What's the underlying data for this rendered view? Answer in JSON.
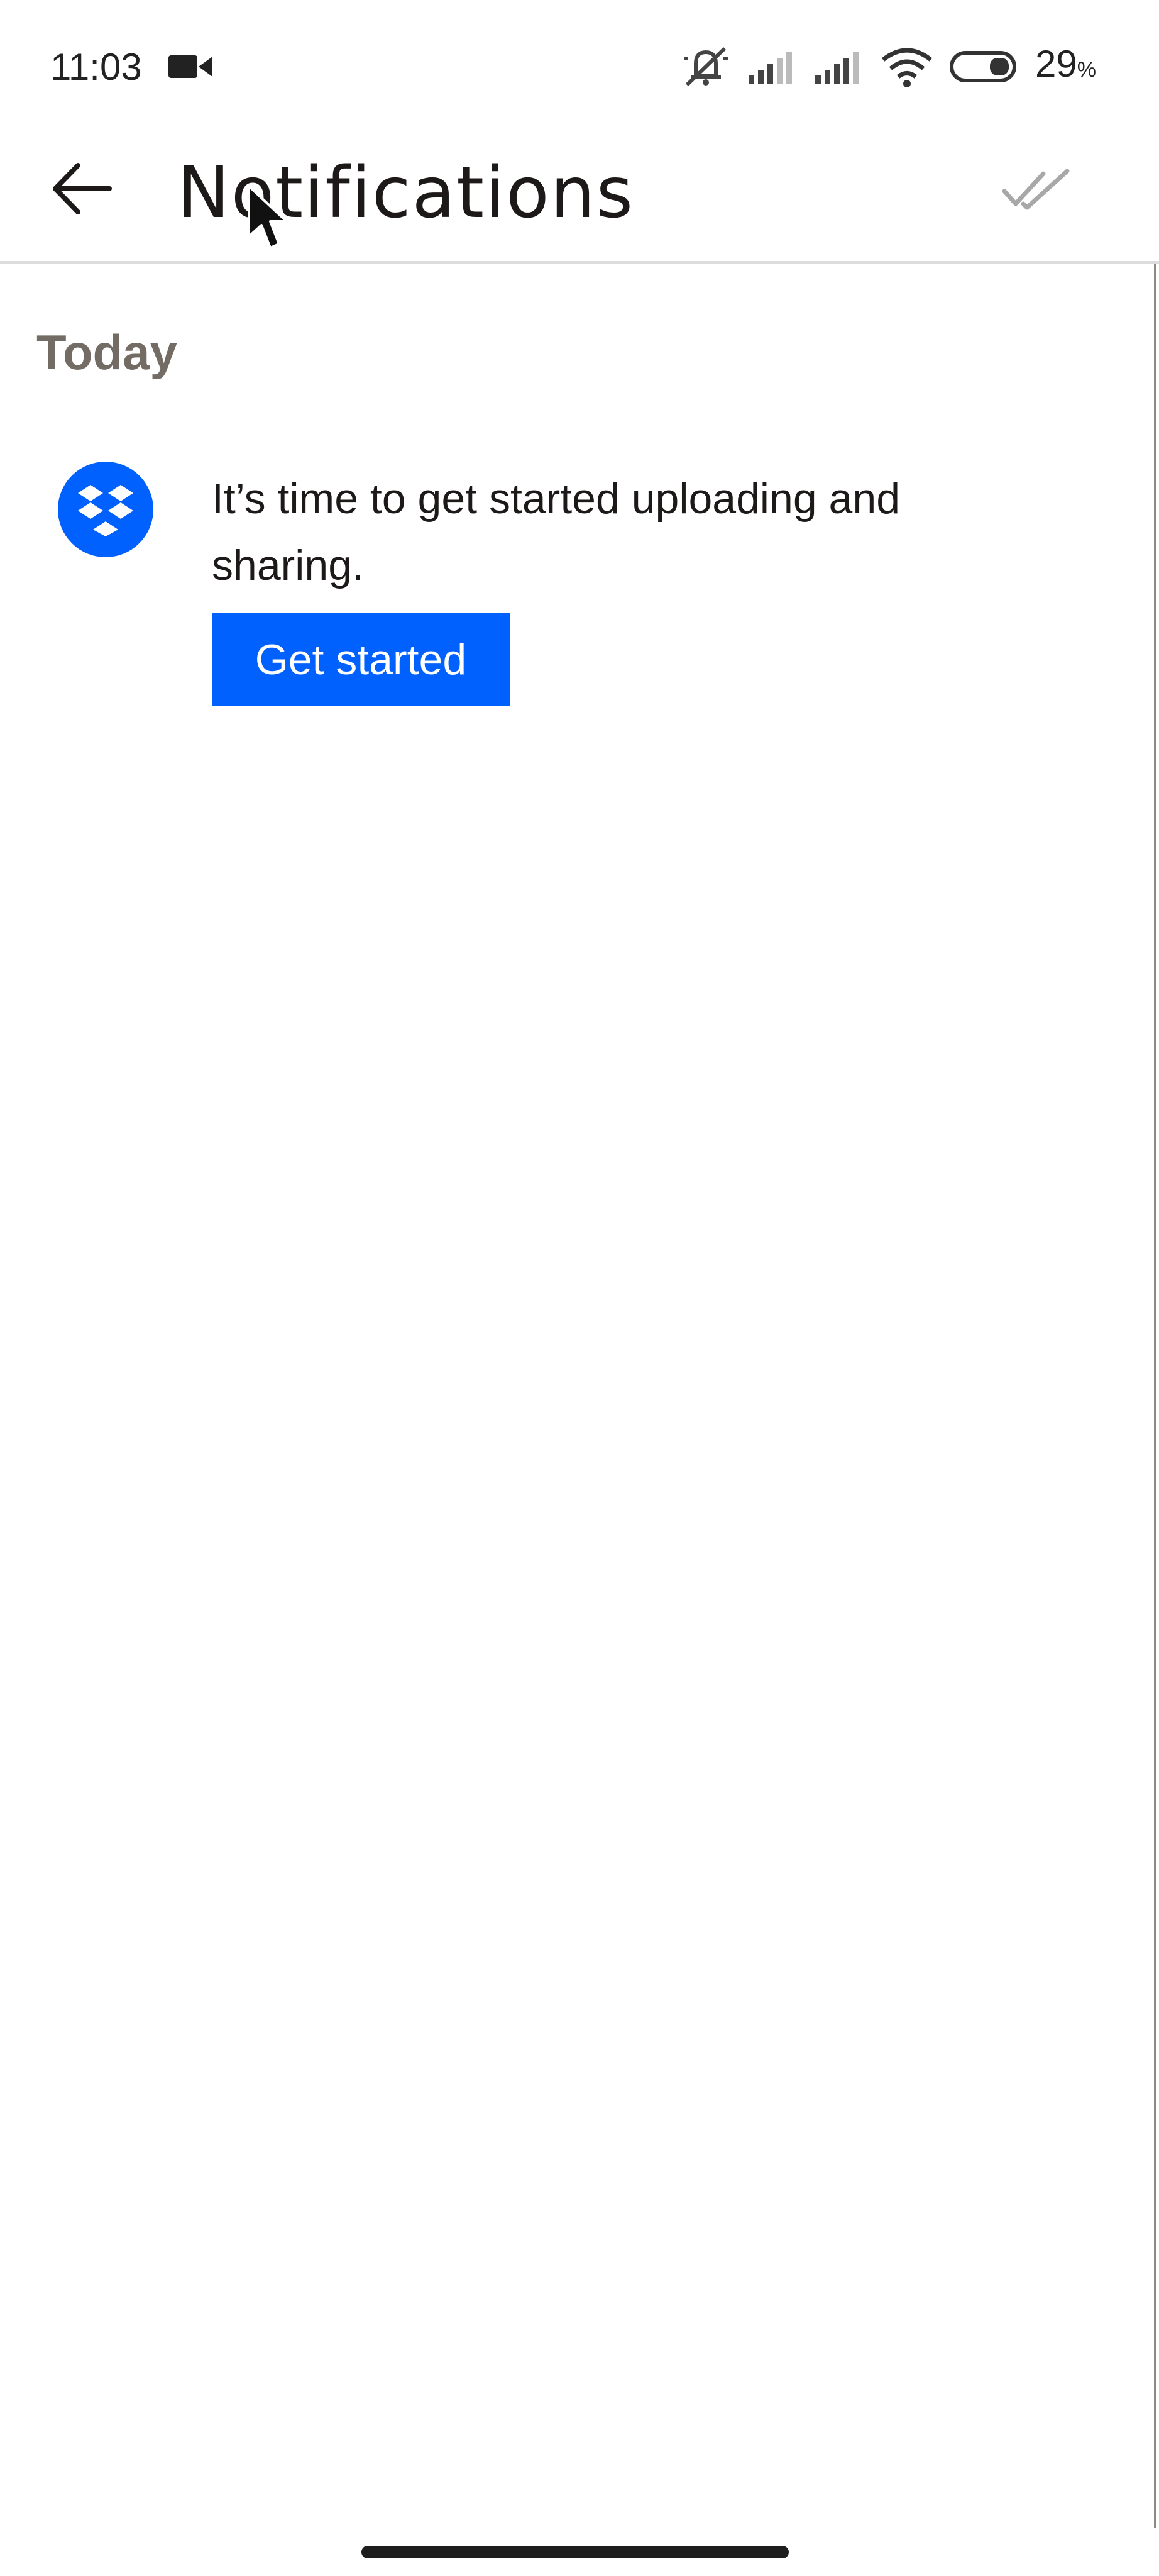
{
  "status_bar": {
    "time": "11:03",
    "battery": "29",
    "battery_unit": "%"
  },
  "header": {
    "title": "Notifications",
    "back_icon": "arrow-left-icon",
    "mark_all_icon": "double-check-icon"
  },
  "sections": [
    {
      "header": "Today",
      "items": [
        {
          "icon": "dropbox-logo-icon",
          "text": "It’s time to get started uploading and sharing.",
          "button_label": "Get started"
        }
      ]
    }
  ],
  "colors": {
    "accent": "#0061fe",
    "section_header": "#736c64",
    "text": "#1e1919"
  }
}
